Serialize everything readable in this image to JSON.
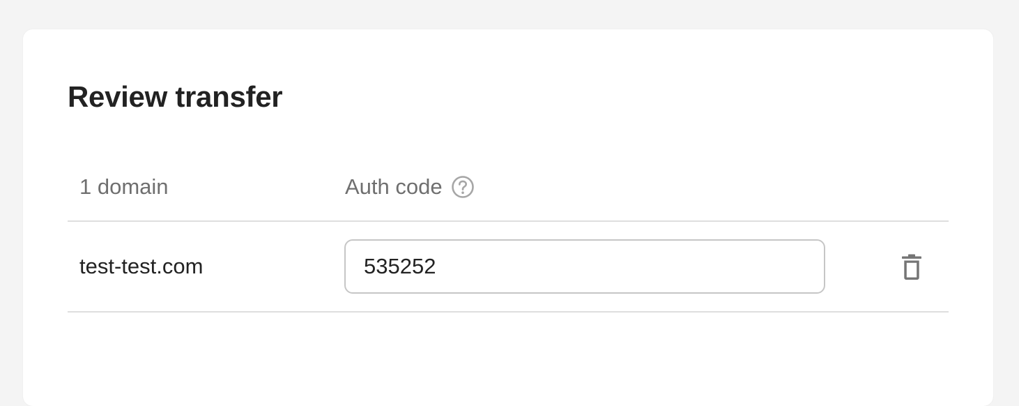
{
  "card": {
    "title": "Review transfer"
  },
  "table": {
    "headers": {
      "domain_count": "1 domain",
      "auth_code": "Auth code"
    },
    "rows": [
      {
        "domain": "test-test.com",
        "auth_code": "535252"
      }
    ]
  },
  "icons": {
    "help": "question-circle-icon",
    "delete": "trash-icon"
  },
  "colors": {
    "background": "#f4f4f4",
    "card": "#ffffff",
    "text_primary": "#222222",
    "text_secondary": "#6f6f6f",
    "icon": "#757575",
    "divider": "#dedede",
    "input_border": "#c6c6c6"
  }
}
